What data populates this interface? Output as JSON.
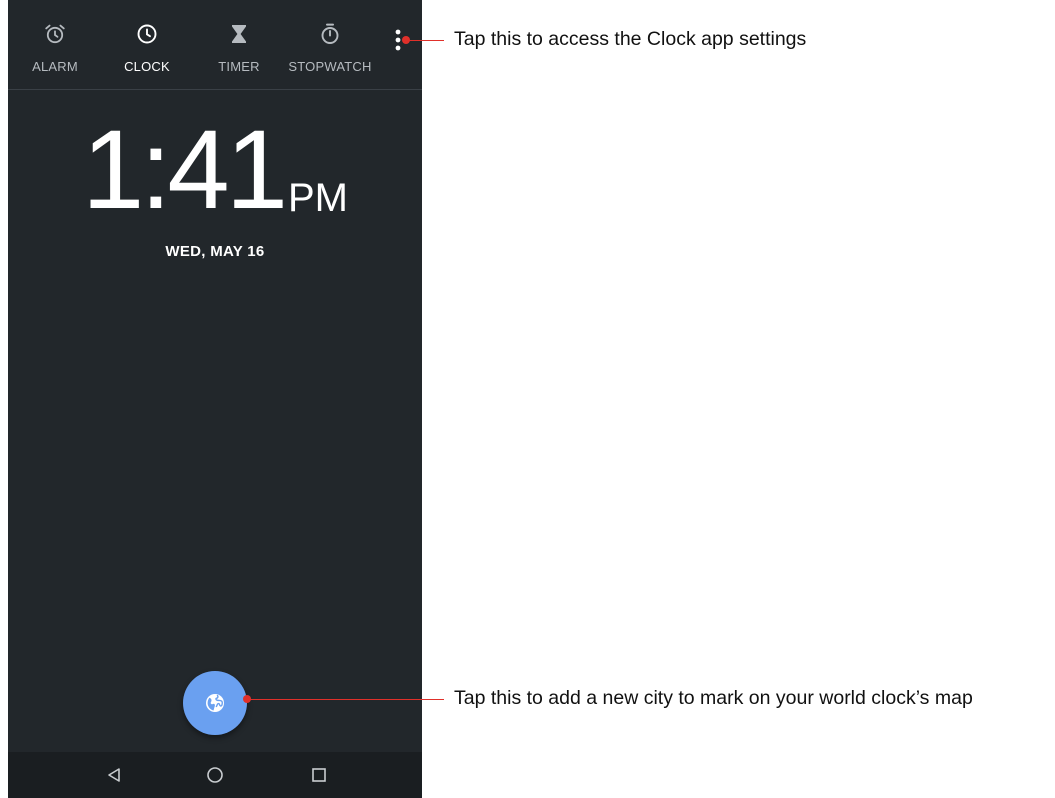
{
  "tabs": [
    {
      "label": "ALARM",
      "icon": "alarm-icon",
      "active": false
    },
    {
      "label": "CLOCK",
      "icon": "clock-icon",
      "active": true
    },
    {
      "label": "TIMER",
      "icon": "hourglass-icon",
      "active": false
    },
    {
      "label": "STOPWATCH",
      "icon": "stopwatch-icon",
      "active": false
    }
  ],
  "overflow_menu": {
    "icon": "more-vert-icon"
  },
  "clock": {
    "time": "1:41",
    "ampm": "PM",
    "date": "WED, MAY 16"
  },
  "fab": {
    "icon": "globe-icon"
  },
  "navbar": {
    "buttons": [
      "back-icon",
      "home-icon",
      "recents-icon"
    ]
  },
  "callouts": {
    "settings": "Tap this to access the Clock app settings",
    "add_city": "Tap this to add a new city to mark on your world clock’s map"
  },
  "colors": {
    "background": "#22272b",
    "fab": "#6aa0f0",
    "callout": "#e0302a",
    "navbar": "#1a1e21"
  }
}
